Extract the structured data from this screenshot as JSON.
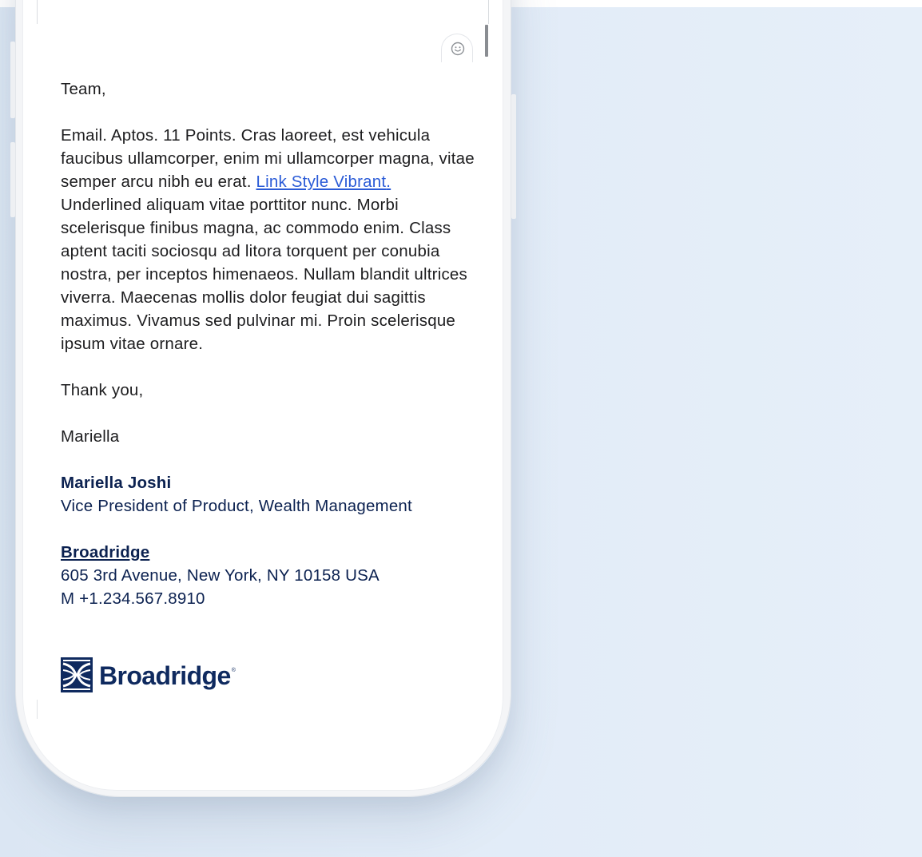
{
  "message": {
    "greeting": "Team,",
    "body_before_link": "Email. Aptos. 11 Points. Cras laoreet, est vehicula faucibus ullamcorper, enim mi ullamcorper magna, vitae semper arcu nibh eu erat. ",
    "link_text": "Link Style Vibrant",
    "link_trailing": ".",
    "body_after_link": " Underlined aliquam vitae porttitor nunc. Morbi scelerisque finibus magna, ac commodo enim. Class aptent taciti sociosqu ad litora torquent per conubia nostra, per inceptos himenaeos. Nullam blandit ultrices viverra. Maecenas mollis dolor feugiat dui sagittis maximus. Vivamus sed pulvinar mi. Proin scelerisque ipsum vitae ornare.",
    "closing": "Thank you,",
    "sender_first_name": "Mariella"
  },
  "signature": {
    "full_name": "Mariella Joshi",
    "title": "Vice President of Product, Wealth Management",
    "company": "Broadridge",
    "address": "605 3rd Avenue, New York, NY 10158 USA",
    "phone": "M +1.234.567.8910",
    "logo_wordmark": "Broadridge",
    "logo_registered": "®"
  },
  "toolbar": {
    "emoji_icon": "smiley-icon"
  },
  "colors": {
    "background": "#e3ecf7",
    "brand_navy": "#0b2150",
    "link_blue": "#2a5bd7",
    "body_text": "#1d1d1f"
  }
}
